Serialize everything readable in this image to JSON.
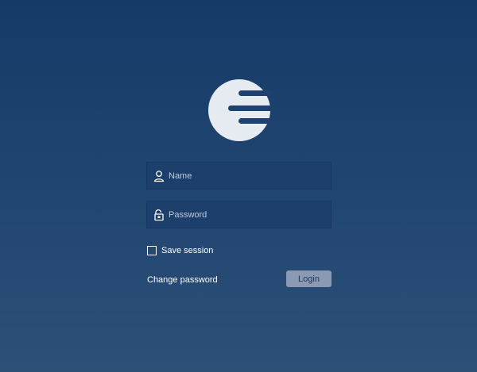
{
  "logo": {
    "icon": "brand-logo-icon"
  },
  "login_form": {
    "name_field": {
      "icon": "user-icon",
      "placeholder": "Name",
      "value": ""
    },
    "password_field": {
      "icon": "lock-icon",
      "placeholder": "Password",
      "value": ""
    },
    "save_session": {
      "label": "Save session",
      "checked": false
    },
    "change_password_link": "Change password",
    "login_button": "Login"
  },
  "colors": {
    "background_top": "#163a67",
    "background_bottom": "#2d5077",
    "logo_fill": "#e6ebf2",
    "field_background": "#1d3f6a",
    "button_background": "#8b9ab2",
    "button_text": "#1b3a63"
  }
}
